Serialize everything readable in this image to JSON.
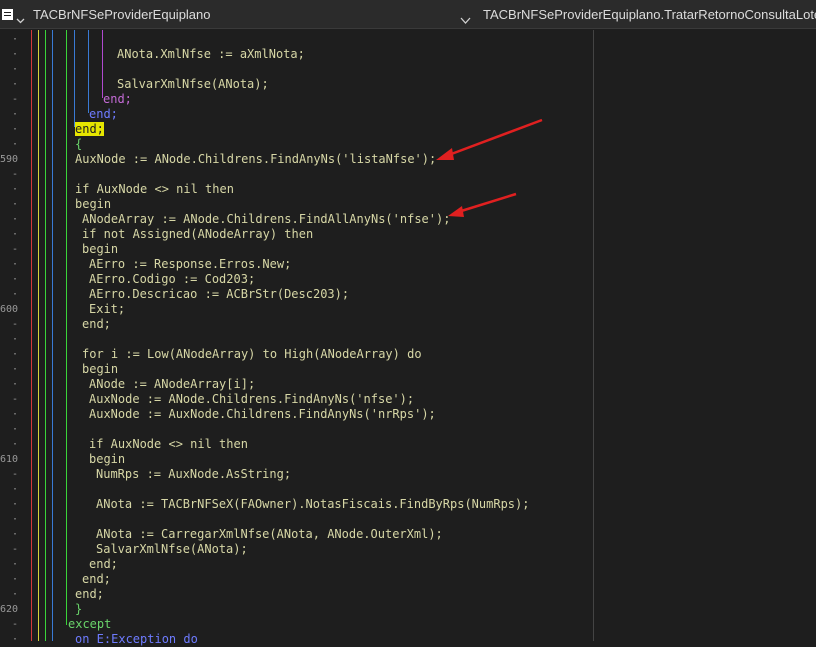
{
  "header": {
    "left_label": "TACBrNFSeProviderEquiplano",
    "right_label": "TACBrNFSeProviderEquiplano.TratarRetornoConsultaLoteRps"
  },
  "gutter": {
    "line_numbers": [
      {
        "text": "590",
        "row": 8
      },
      {
        "text": "600",
        "row": 18
      },
      {
        "text": "610",
        "row": 28
      },
      {
        "text": "620",
        "row": 38
      }
    ]
  },
  "code_lines": [
    {
      "row": 0,
      "text": "",
      "indent": 0
    },
    {
      "row": 1,
      "text": "ANota.XmlNfse := aXmlNota;",
      "indent": 8
    },
    {
      "row": 2,
      "text": "",
      "indent": 0
    },
    {
      "row": 3,
      "text": "SalvarXmlNfse(ANota);",
      "indent": 8
    },
    {
      "row": 4,
      "text": "end;",
      "indent": 6,
      "style": "purple-end"
    },
    {
      "row": 5,
      "text": "end;",
      "indent": 4,
      "style": "blue-end"
    },
    {
      "row": 6,
      "text": "end;",
      "indent": 2,
      "style": "hl-end"
    },
    {
      "row": 7,
      "text": "{",
      "indent": 2,
      "style": "green"
    },
    {
      "row": 8,
      "text": "AuxNode := ANode.Childrens.FindAnyNs('listaNfse');",
      "indent": 2
    },
    {
      "row": 9,
      "text": "",
      "indent": 0
    },
    {
      "row": 10,
      "text": "if AuxNode <> nil then",
      "indent": 2
    },
    {
      "row": 11,
      "text": "begin",
      "indent": 2
    },
    {
      "row": 12,
      "text": "ANodeArray := ANode.Childrens.FindAllAnyNs('nfse');",
      "indent": 3
    },
    {
      "row": 13,
      "text": "if not Assigned(ANodeArray) then",
      "indent": 3
    },
    {
      "row": 14,
      "text": "begin",
      "indent": 3
    },
    {
      "row": 15,
      "text": "AErro := Response.Erros.New;",
      "indent": 4
    },
    {
      "row": 16,
      "text": "AErro.Codigo := Cod203;",
      "indent": 4
    },
    {
      "row": 17,
      "text": "AErro.Descricao := ACBrStr(Desc203);",
      "indent": 4
    },
    {
      "row": 18,
      "text": "Exit;",
      "indent": 4
    },
    {
      "row": 19,
      "text": "end;",
      "indent": 3
    },
    {
      "row": 20,
      "text": "",
      "indent": 0
    },
    {
      "row": 21,
      "text": "for i := Low(ANodeArray) to High(ANodeArray) do",
      "indent": 3
    },
    {
      "row": 22,
      "text": "begin",
      "indent": 3
    },
    {
      "row": 23,
      "text": "ANode := ANodeArray[i];",
      "indent": 4
    },
    {
      "row": 24,
      "text": "AuxNode := ANode.Childrens.FindAnyNs('nfse');",
      "indent": 4
    },
    {
      "row": 25,
      "text": "AuxNode := AuxNode.Childrens.FindAnyNs('nrRps');",
      "indent": 4
    },
    {
      "row": 26,
      "text": "",
      "indent": 0
    },
    {
      "row": 27,
      "text": "if AuxNode <> nil then",
      "indent": 4
    },
    {
      "row": 28,
      "text": "begin",
      "indent": 4
    },
    {
      "row": 29,
      "text": "NumRps := AuxNode.AsString;",
      "indent": 5
    },
    {
      "row": 30,
      "text": "",
      "indent": 0
    },
    {
      "row": 31,
      "text": "ANota := TACBrNFSeX(FAOwner).NotasFiscais.FindByRps(NumRps);",
      "indent": 5
    },
    {
      "row": 32,
      "text": "",
      "indent": 0
    },
    {
      "row": 33,
      "text": "ANota := CarregarXmlNfse(ANota, ANode.OuterXml);",
      "indent": 5
    },
    {
      "row": 34,
      "text": "SalvarXmlNfse(ANota);",
      "indent": 5
    },
    {
      "row": 35,
      "text": "end;",
      "indent": 4
    },
    {
      "row": 36,
      "text": "end;",
      "indent": 3
    },
    {
      "row": 37,
      "text": "end;",
      "indent": 2
    },
    {
      "row": 38,
      "text": "}",
      "indent": 2,
      "style": "green"
    },
    {
      "row": 39,
      "text": "except",
      "indent": 1,
      "style": "green"
    },
    {
      "row": 40,
      "text": "on E:Exception do",
      "indent": 2,
      "style": "blue-partial"
    }
  ],
  "colors": {
    "background": "#1e1e1e",
    "code_text": "#d7d7a6",
    "arrow": "#e02020",
    "highlight": "#e6e600"
  }
}
